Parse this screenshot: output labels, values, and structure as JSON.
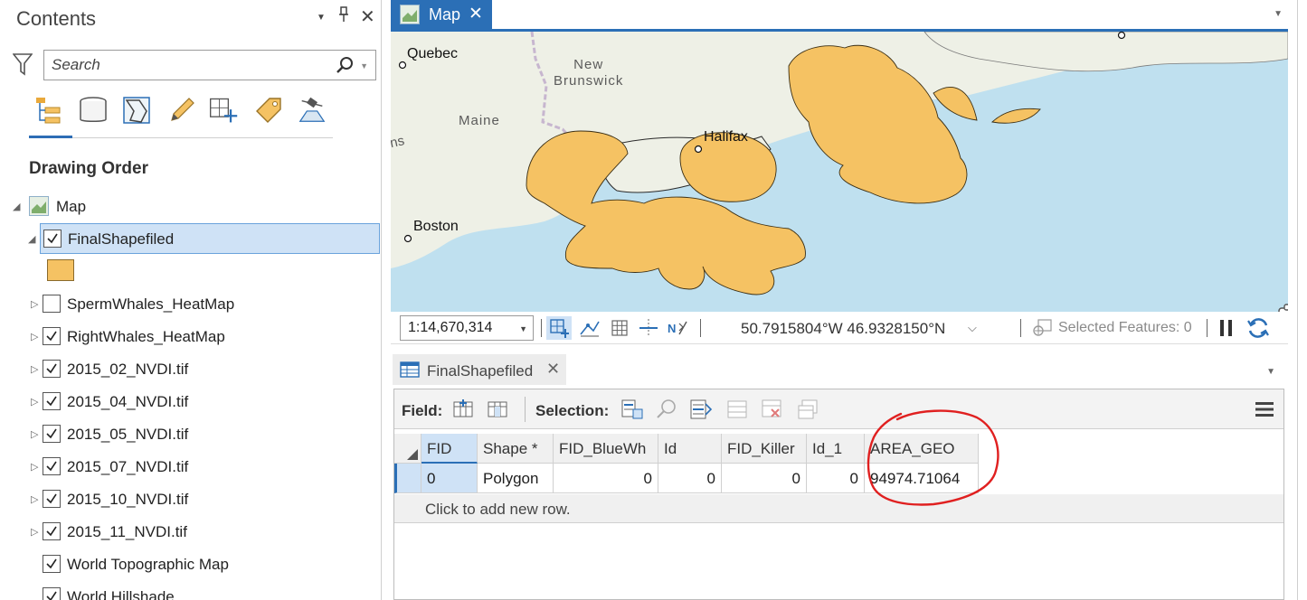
{
  "contents_pane": {
    "title": "Contents",
    "search_placeholder": "Search",
    "heading": "Drawing Order",
    "tools": [
      "list-by-drawing-order",
      "list-by-data-source",
      "list-by-selection",
      "list-by-editing",
      "list-by-snapping",
      "list-by-labeling",
      "list-by-perspective-imagery"
    ],
    "map_name": "Map",
    "layers": [
      {
        "name": "FinalShapefiled",
        "checked": true,
        "selected": true
      },
      {
        "name": "SpermWhales_HeatMap",
        "checked": false
      },
      {
        "name": "RightWhales_HeatMap",
        "checked": true
      },
      {
        "name": "2015_02_NVDI.tif",
        "checked": true
      },
      {
        "name": "2015_04_NVDI.tif",
        "checked": true
      },
      {
        "name": "2015_05_NVDI.tif",
        "checked": true
      },
      {
        "name": "2015_07_NVDI.tif",
        "checked": true
      },
      {
        "name": "2015_10_NVDI.tif",
        "checked": true
      },
      {
        "name": "2015_11_NVDI.tif",
        "checked": true
      },
      {
        "name": "World Topographic Map",
        "checked": true
      },
      {
        "name": "World Hillshade",
        "checked": true
      }
    ],
    "symbol_color": "#f5c263"
  },
  "map_view": {
    "tab_label": "Map",
    "labels": {
      "quebec": "Quebec",
      "new_brunswick": "New\nBrunswick",
      "maine": "Maine",
      "halifax": "Halifax",
      "boston": "Boston",
      "ins": "ins"
    },
    "water_color": "#bfe0ef",
    "land_color": "#eef0e6",
    "polygon_color": "#f5c263"
  },
  "map_status": {
    "scale": "1:14,670,314",
    "coordinates": "50.7915804°W 46.9328150°N",
    "selected_features": "Selected Features: 0"
  },
  "attribute_table": {
    "tab_label": "FinalShapefiled",
    "field_label": "Field:",
    "selection_label": "Selection:",
    "columns": [
      "FID",
      "Shape *",
      "FID_BlueWh",
      "Id",
      "FID_Killer",
      "Id_1",
      "AREA_GEO"
    ],
    "rows": [
      [
        "0",
        "Polygon",
        "0",
        "0",
        "0",
        "0",
        "94974.71064"
      ]
    ],
    "add_row_text": "Click to add new row.",
    "annotation_color": "#e02020"
  }
}
